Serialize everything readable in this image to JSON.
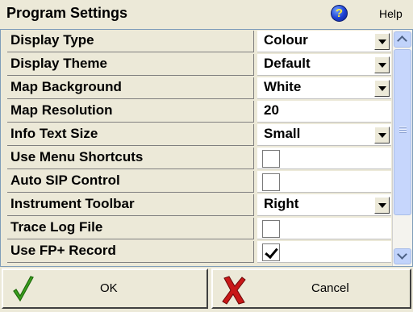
{
  "header": {
    "title": "Program Settings",
    "help_label": "Help",
    "help_glyph": "?"
  },
  "settings": [
    {
      "label": "Display Type",
      "kind": "dropdown",
      "value": "Colour"
    },
    {
      "label": "Display Theme",
      "kind": "dropdown",
      "value": "Default"
    },
    {
      "label": "Map Background",
      "kind": "dropdown",
      "value": "White"
    },
    {
      "label": "Map Resolution",
      "kind": "text",
      "value": "20"
    },
    {
      "label": "Info Text Size",
      "kind": "dropdown",
      "value": "Small"
    },
    {
      "label": "Use Menu Shortcuts",
      "kind": "checkbox",
      "checked": false
    },
    {
      "label": "Auto SIP Control",
      "kind": "checkbox",
      "checked": false
    },
    {
      "label": "Instrument Toolbar",
      "kind": "dropdown",
      "value": "Right"
    },
    {
      "label": "Trace Log File",
      "kind": "checkbox",
      "checked": false
    },
    {
      "label": "Use FP+ Record",
      "kind": "checkbox",
      "checked": true
    }
  ],
  "footer": {
    "ok_label": "OK",
    "cancel_label": "Cancel"
  },
  "icons": {
    "help": "help-icon",
    "ok": "checkmark-icon",
    "cancel": "x-mark-icon"
  },
  "colors": {
    "help_icon": "#1c3fd1",
    "ok_icon": "#3aa01e",
    "cancel_icon": "#c81818"
  }
}
